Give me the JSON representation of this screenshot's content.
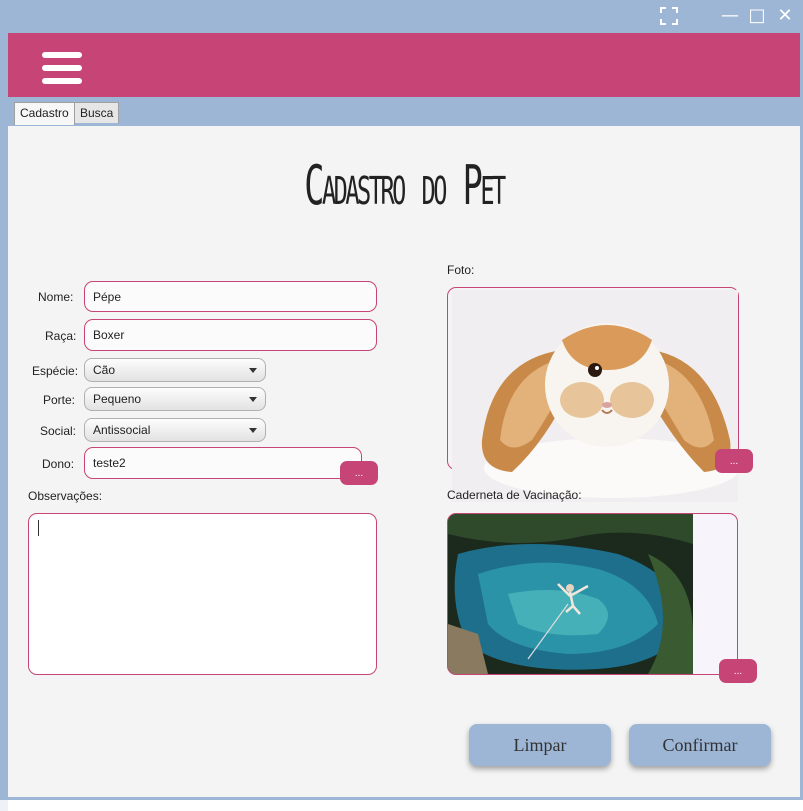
{
  "window": {
    "maximize_alt_icon": "fullscreen-icon",
    "minimize_glyph": "—",
    "maximize_glyph": "□",
    "close_glyph": "✕"
  },
  "tabs": [
    {
      "label": "Cadastro",
      "active": true
    },
    {
      "label": "Busca",
      "active": false
    }
  ],
  "page_title": "Cadastro do Pet",
  "form": {
    "nome_label": "Nome:",
    "nome_value": "Pépe",
    "raca_label": "Raça:",
    "raca_value": "Boxer",
    "especie_label": "Espécie:",
    "especie_value": "Cão",
    "porte_label": "Porte:",
    "porte_value": "Pequeno",
    "social_label": "Social:",
    "social_value": "Antissocial",
    "dono_label": "Dono:",
    "dono_value": "teste2",
    "browse_label": "...",
    "observacoes_label": "Observações:"
  },
  "foto": {
    "label": "Foto:",
    "browse_label": "..."
  },
  "caderneta": {
    "label": "Caderneta de Vacinação:",
    "browse_label": "..."
  },
  "actions": {
    "limpar": "Limpar",
    "confirmar": "Confirmar"
  },
  "colors": {
    "accent": "#c64576",
    "window": "#9db6d6",
    "panel": "#f4f4f4"
  }
}
